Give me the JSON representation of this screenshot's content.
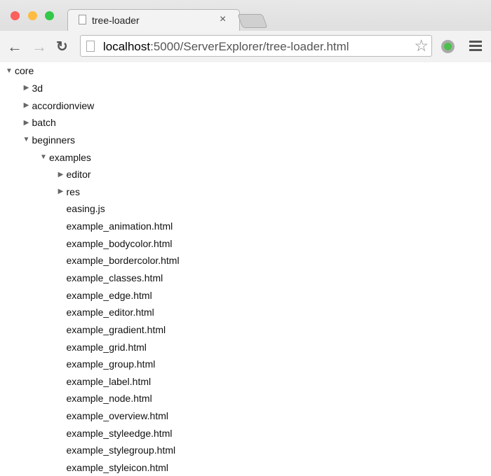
{
  "browser": {
    "tab_title": "tree-loader",
    "url_host": "localhost",
    "url_rest": ":5000/ServerExplorer/tree-loader.html",
    "traffic_colors": [
      "#fc605c",
      "#fdbc40",
      "#34c84a"
    ]
  },
  "tree": [
    {
      "label": "core",
      "level": 0,
      "state": "open"
    },
    {
      "label": "3d",
      "level": 1,
      "state": "closed"
    },
    {
      "label": "accordionview",
      "level": 1,
      "state": "closed"
    },
    {
      "label": "batch",
      "level": 1,
      "state": "closed"
    },
    {
      "label": "beginners",
      "level": 1,
      "state": "open"
    },
    {
      "label": "examples",
      "level": 2,
      "state": "open"
    },
    {
      "label": "editor",
      "level": 3,
      "state": "closed"
    },
    {
      "label": "res",
      "level": 3,
      "state": "closed"
    },
    {
      "label": "easing.js",
      "level": 3,
      "state": "leaf"
    },
    {
      "label": "example_animation.html",
      "level": 3,
      "state": "leaf"
    },
    {
      "label": "example_bodycolor.html",
      "level": 3,
      "state": "leaf"
    },
    {
      "label": "example_bordercolor.html",
      "level": 3,
      "state": "leaf"
    },
    {
      "label": "example_classes.html",
      "level": 3,
      "state": "leaf"
    },
    {
      "label": "example_edge.html",
      "level": 3,
      "state": "leaf"
    },
    {
      "label": "example_editor.html",
      "level": 3,
      "state": "leaf"
    },
    {
      "label": "example_gradient.html",
      "level": 3,
      "state": "leaf"
    },
    {
      "label": "example_grid.html",
      "level": 3,
      "state": "leaf"
    },
    {
      "label": "example_group.html",
      "level": 3,
      "state": "leaf"
    },
    {
      "label": "example_label.html",
      "level": 3,
      "state": "leaf"
    },
    {
      "label": "example_node.html",
      "level": 3,
      "state": "leaf"
    },
    {
      "label": "example_overview.html",
      "level": 3,
      "state": "leaf"
    },
    {
      "label": "example_styleedge.html",
      "level": 3,
      "state": "leaf"
    },
    {
      "label": "example_stylegroup.html",
      "level": 3,
      "state": "leaf"
    },
    {
      "label": "example_styleicon.html",
      "level": 3,
      "state": "leaf"
    }
  ]
}
